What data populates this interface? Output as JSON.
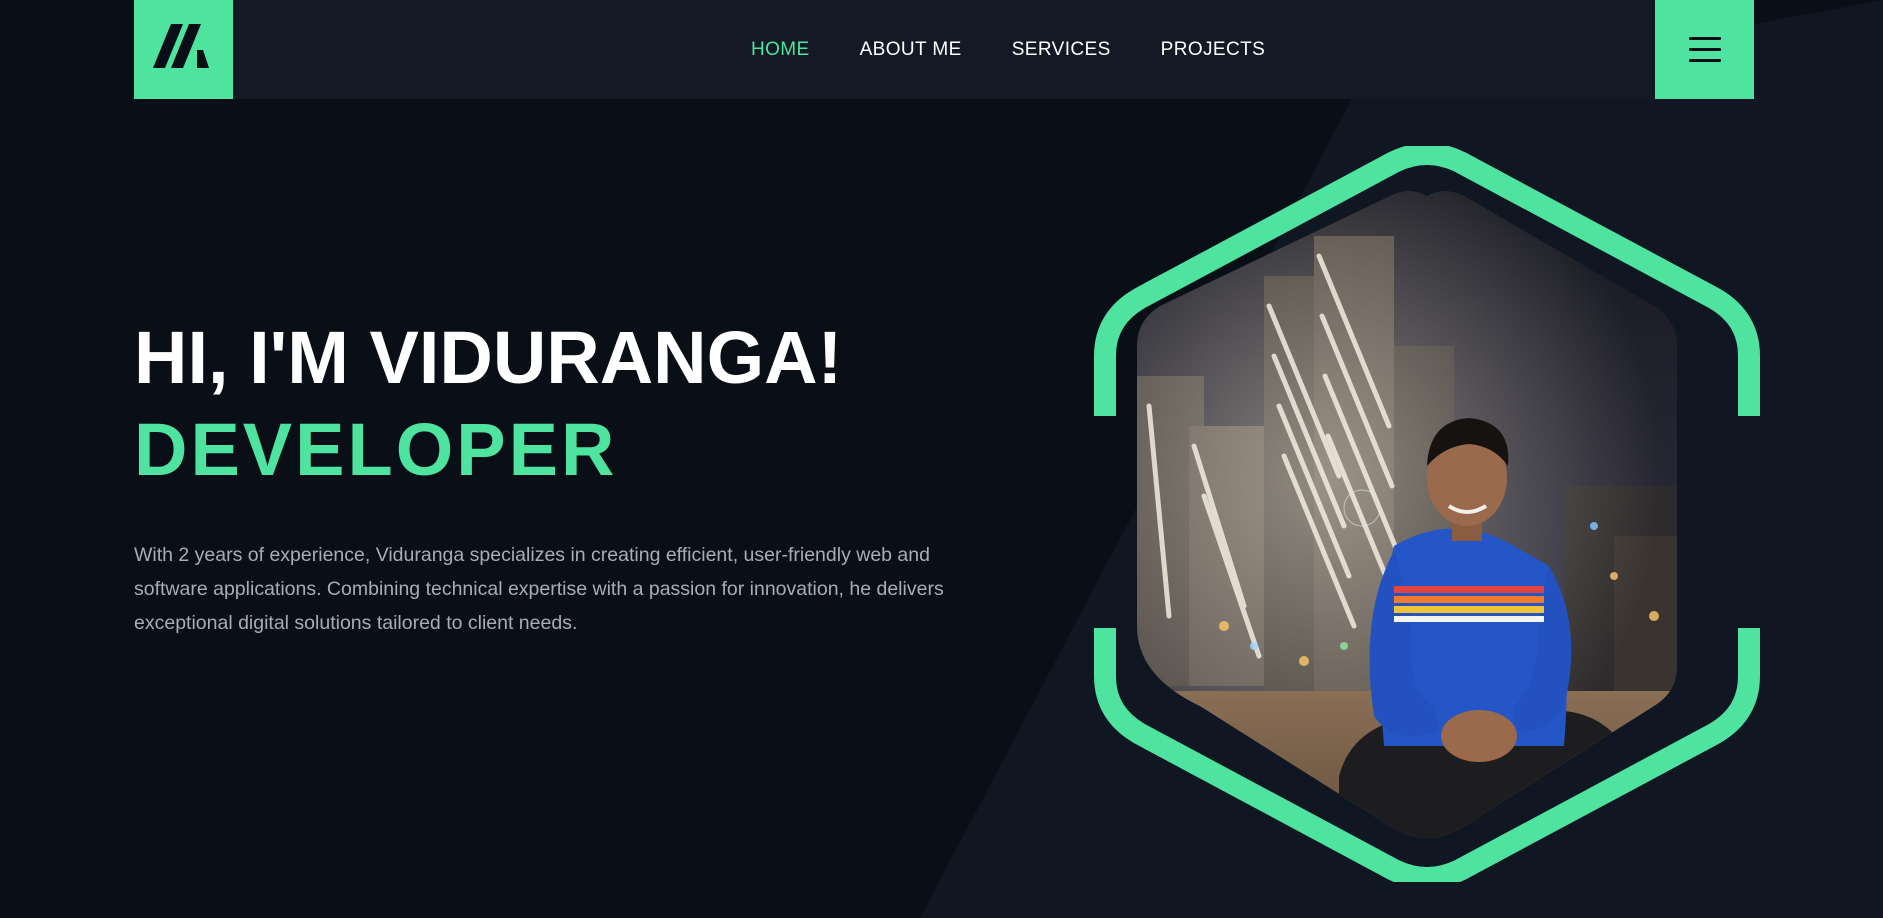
{
  "header": {
    "logo": {
      "icon": "slash-logo-icon",
      "color": "#4ee39e"
    },
    "nav": [
      {
        "label": "HOME",
        "active": true
      },
      {
        "label": "ABOUT ME",
        "active": false
      },
      {
        "label": "SERVICES",
        "active": false
      },
      {
        "label": "PROJECTS",
        "active": false
      }
    ],
    "menu_button": {
      "icon": "hamburger-menu-icon"
    }
  },
  "hero": {
    "title": "HI, I'M VIDURANGA!",
    "role": "DEVELOPER",
    "description": "With 2 years of experience, Viduranga specializes in creating efficient, user-friendly web and software applications. Combining technical expertise with a passion for innovation, he delivers exceptional digital solutions tailored to client needs."
  },
  "portrait": {
    "frame_color": "#4ee39e"
  },
  "colors": {
    "accent": "#4ee39e",
    "background": "#0a0f17",
    "header_bg": "#141a25",
    "text_muted": "#a6adb8"
  }
}
